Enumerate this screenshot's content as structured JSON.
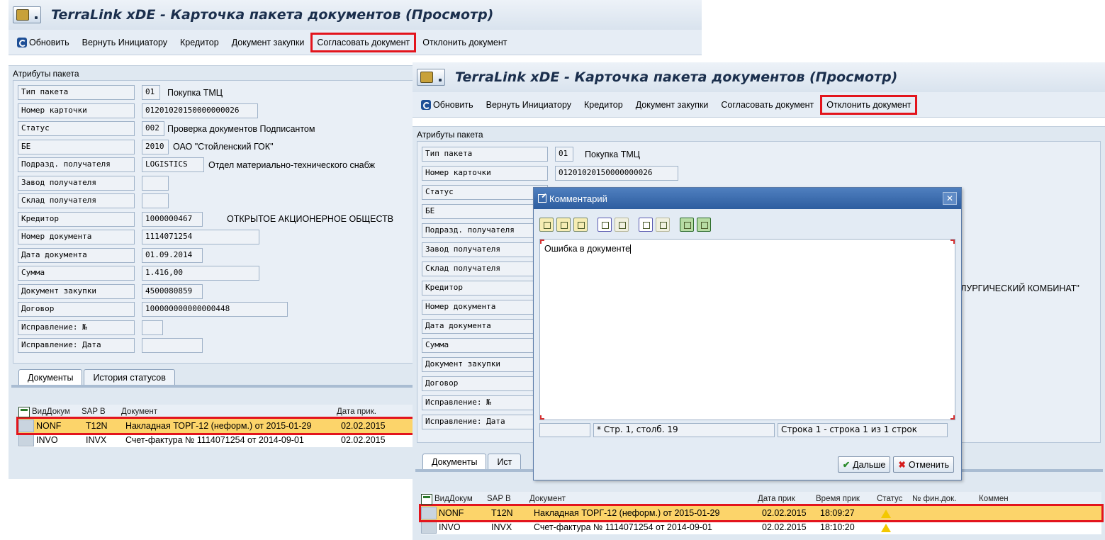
{
  "window_title": "TerraLink xDE - Карточка пакета документов (Просмотр)",
  "toolbar": {
    "refresh": "Обновить",
    "return_initiator": "Вернуть Инициатору",
    "creditor": "Кредитор",
    "purchase_doc": "Документ закупки",
    "approve": "Согласовать документ",
    "reject": "Отклонить документ"
  },
  "group_title": "Атрибуты пакета",
  "labels": {
    "type": "Тип пакета",
    "card_no": "Номер карточки",
    "status": "Статус",
    "be": "БЕ",
    "dept": "Подразд. получателя",
    "plant": "Завод получателя",
    "warehouse": "Склад получателя",
    "creditor": "Кредитор",
    "doc_no": "Номер документа",
    "doc_date": "Дата документа",
    "amount": "Сумма",
    "purchase_doc": "Документ закупки",
    "contract": "Договор",
    "correction_no": "Исправление: №",
    "correction_date": "Исправление: Дата"
  },
  "values": {
    "type_code": "01",
    "type_desc": "Покупка ТМЦ",
    "card_no": "01201020150000000026",
    "status_code": "002",
    "status_desc": "Проверка документов Подписантом",
    "be_code": "2010",
    "be_desc": "ОАО \"Стойленский ГОК\"",
    "dept_code": "LOGISTICS",
    "dept_desc": "Отдел материально-технического снабж",
    "creditor_code": "1000000467",
    "creditor_desc": "ОТКРЫТОЕ АКЦИОНЕРНОЕ ОБЩЕСТВ",
    "creditor_desc_tail": "ЛЛУРГИЧЕСКИЙ КОМБИНАТ\"",
    "doc_no": "1114071254",
    "doc_date": "01.09.2014",
    "amount": "1.416,00",
    "purchase_doc": "4500080859",
    "contract": "100000000000000448"
  },
  "tabs": {
    "documents": "Документы",
    "history": "История статусов",
    "history_short": "Ист"
  },
  "grid": {
    "headers": {
      "doctype": "ВидДокум",
      "sap": "SAP В",
      "doc": "Документ",
      "date": "Дата прик.",
      "date_short": "Дата прик",
      "time": "Время прик",
      "status": "Статус",
      "fin_doc": "№ фин.док.",
      "comment": "Коммен"
    },
    "rows": [
      {
        "type": "NONF",
        "sap": "T12N",
        "doc": "Накладная ТОРГ-12 (неформ.) от 2015-01-29",
        "date": "02.02.2015",
        "time": "18:09:27"
      },
      {
        "type": "INVO",
        "sap": "INVX",
        "doc": "Счет-фактура № 1114071254 от 2014-09-01",
        "date": "02.02.2015",
        "time": "18:10:20"
      }
    ]
  },
  "dialog": {
    "title": "Комментарий",
    "text": "Ошибка в документе",
    "status_star": "*",
    "status_pos": "Стр. 1, столб. 19",
    "status_lines": "Строка 1 - строка 1 из 1 строк",
    "ok": "Дальше",
    "cancel": "Отменить",
    "close_glyph": "✕"
  }
}
